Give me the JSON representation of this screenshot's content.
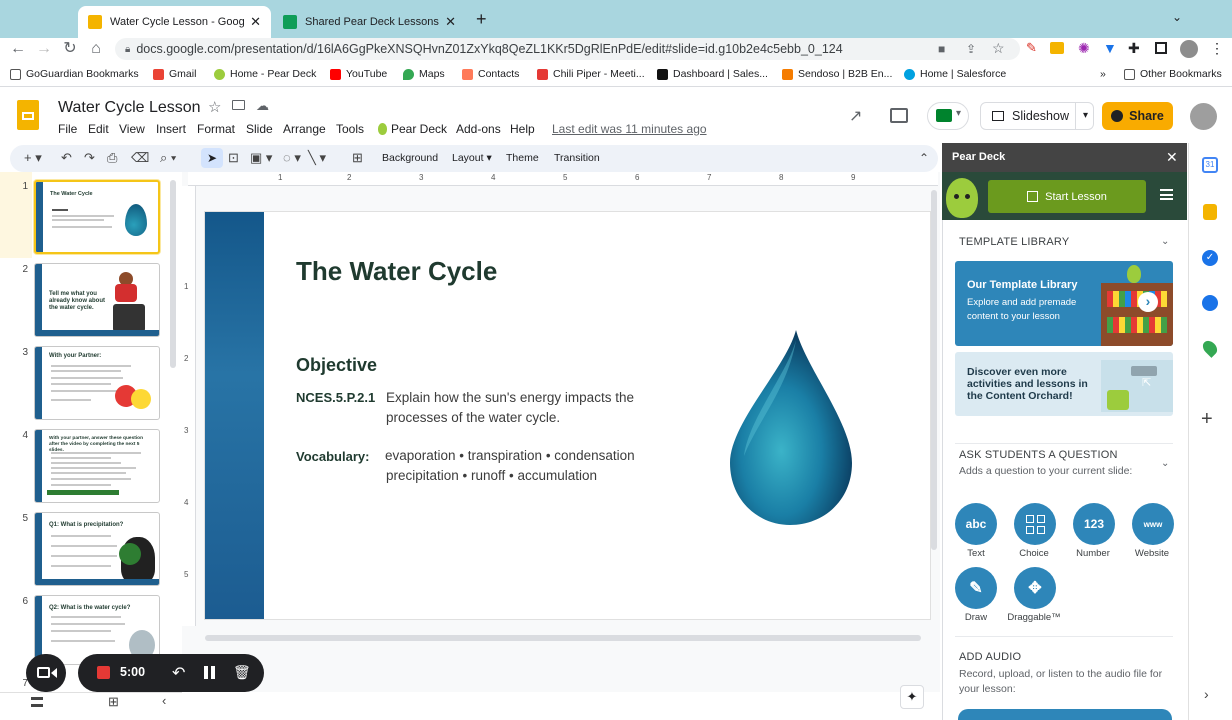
{
  "browser": {
    "tabs": [
      {
        "title": "Water Cycle Lesson - Google S",
        "icon": "slides-icon"
      },
      {
        "title": "Shared Pear Deck Lessons - G",
        "icon": "sheets-icon"
      }
    ],
    "url": "docs.google.com/presentation/d/16lA6GgPkeXNSQHvnZ01ZxYkq8QeZL1KKr5DgRlEnPdE/edit#slide=id.g10b2e4c5ebb_0_124",
    "bookmarks": [
      "GoGuardian Bookmarks",
      "Gmail",
      "Home - Pear Deck",
      "YouTube",
      "Maps",
      "Contacts",
      "Chili Piper - Meeti...",
      "Dashboard | Sales...",
      "Sendoso | B2B En...",
      "Home | Salesforce"
    ],
    "more": "»",
    "other_bookmarks": "Other Bookmarks"
  },
  "docs": {
    "title": "Water Cycle Lesson",
    "menu": [
      "File",
      "Edit",
      "View",
      "Insert",
      "Format",
      "Slide",
      "Arrange",
      "Tools",
      "Pear Deck",
      "Add-ons",
      "Help"
    ],
    "last_edit": "Last edit was 11 minutes ago",
    "slideshow": "Slideshow",
    "share": "Share"
  },
  "toolbar": {
    "background": "Background",
    "layout": "Layout",
    "theme": "Theme",
    "transition": "Transition"
  },
  "ruler": [
    "1",
    "2",
    "3",
    "4",
    "5",
    "6",
    "7",
    "8",
    "9"
  ],
  "filmstrip": {
    "numbers": [
      "1",
      "2",
      "3",
      "4",
      "5",
      "6",
      "7"
    ],
    "t1_title": "The Water Cycle",
    "t2_title": "Tell me what you already know about the water cycle.",
    "t3_title": "With your Partner:",
    "t4_title": "With your partner, answer these question after the video by completing the next 5 slides.",
    "t5_title": "Q1: What is precipitation?",
    "t6_title": "Q2: What is the water cycle?"
  },
  "slide": {
    "title": "The Water Cycle",
    "objective_heading": "Objective",
    "standard": "NCES.5.P.2.1",
    "objective_text": "Explain how the sun's energy impacts the processes of the water cycle.",
    "vocab_label": "Vocabulary:",
    "vocab_line1": "evaporation • transpiration • condensation",
    "vocab_line2": "precipitation • runoff • accumulation"
  },
  "pear_deck": {
    "header": "Pear Deck",
    "start": "Start Lesson",
    "template_library": "TEMPLATE LIBRARY",
    "card1_title": "Our Template Library",
    "card1_text": "Explore and add premade content to your lesson",
    "card2_text": "Discover even more activities and lessons in the Content Orchard!",
    "ask_title": "ASK STUDENTS A QUESTION",
    "ask_sub": "Adds a question to your current slide:",
    "questions": [
      {
        "icon": "abc",
        "label": "Text"
      },
      {
        "icon": "",
        "label": "Choice"
      },
      {
        "icon": "123",
        "label": "Number"
      },
      {
        "icon": "www",
        "label": "Website"
      },
      {
        "icon": "",
        "label": "Draw"
      },
      {
        "icon": "",
        "label": "Draggable™"
      }
    ],
    "audio_title": "ADD AUDIO",
    "audio_text": "Record, upload, or listen to the audio file for your lesson:"
  },
  "recorder": {
    "time": "5:00"
  },
  "colors": {
    "accent": "#f9ab00",
    "slide_blue": "#1f5f8e",
    "pear_green": "#6b9a1e",
    "question_blue": "#2e86b9"
  }
}
